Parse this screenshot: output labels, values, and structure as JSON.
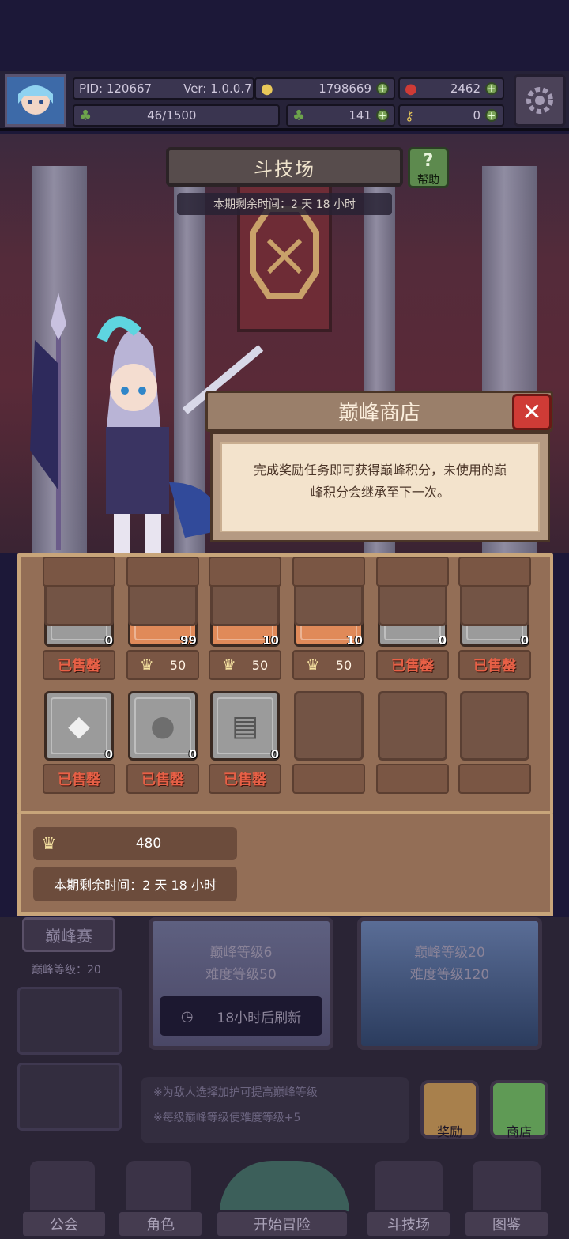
{
  "status": {
    "pid": "PID: 120667",
    "version": "Ver: 1.0.0.7",
    "gold": "1798669",
    "gems": "2462",
    "exp": "46/1500",
    "clover": "141",
    "keys": "0"
  },
  "arena": {
    "title": "斗技场",
    "help_label": "帮助",
    "remaining": "本期剩余时间：2 天 18 小时"
  },
  "shop": {
    "title": "巅峰商店",
    "close_glyph": "✕",
    "description": "完成奖励任务即可获得巅峰积分，未使用的巅峰积分会继承至下一次。",
    "items": [
      {
        "icon": "silver-box-icon",
        "glyph": "▣",
        "qty": "0",
        "price": "已售罄",
        "sold": true,
        "bg": "gray"
      },
      {
        "icon": "treasure-chest-icon",
        "glyph": "🧰",
        "qty": "99",
        "price": "50",
        "sold": false,
        "bg": "orange"
      },
      {
        "icon": "four-leaf-clover-icon",
        "glyph": "☘",
        "qty": "10",
        "price": "50",
        "sold": false,
        "bg": "orange"
      },
      {
        "icon": "love-letter-icon",
        "glyph": "✉",
        "qty": "10",
        "price": "50",
        "sold": false,
        "bg": "orange"
      },
      {
        "icon": "black-envelope-icon",
        "glyph": "✉",
        "qty": "0",
        "price": "已售罄",
        "sold": true,
        "bg": "gray"
      },
      {
        "icon": "white-gem-icon",
        "glyph": "◆",
        "qty": "0",
        "price": "已售罄",
        "sold": true,
        "bg": "gray"
      },
      {
        "icon": "white-gem-icon",
        "glyph": "◆",
        "qty": "0",
        "price": "已售罄",
        "sold": true,
        "bg": "gray"
      },
      {
        "icon": "stone-ore-icon",
        "glyph": "●",
        "qty": "0",
        "price": "已售罄",
        "sold": true,
        "bg": "gray"
      },
      {
        "icon": "book-icon",
        "glyph": "▤",
        "qty": "0",
        "price": "已售罄",
        "sold": true,
        "bg": "gray"
      }
    ],
    "points": "480",
    "remaining": "本期剩余时间：2 天 18 小时"
  },
  "peak": {
    "button": "巅峰赛",
    "level": "巅峰等级：20",
    "card1_line1": "巅峰等级6",
    "card1_line2": "难度等级50",
    "card2_line1": "巅峰等级20",
    "card2_line2": "难度等级120",
    "refresh": "18小时后刷新",
    "note1": "※为敌人选择加护可提高巅峰等级",
    "note2": "※每级巅峰等级使难度等级+5",
    "reward_label": "奖励",
    "store_label": "商店"
  },
  "nav": {
    "guild": "公会",
    "character": "角色",
    "adventure": "开始冒险",
    "arena": "斗技场",
    "codex": "图鉴"
  },
  "colors": {
    "panel": "#936e56",
    "sold": "#e76046",
    "close": "#cf3b36"
  }
}
